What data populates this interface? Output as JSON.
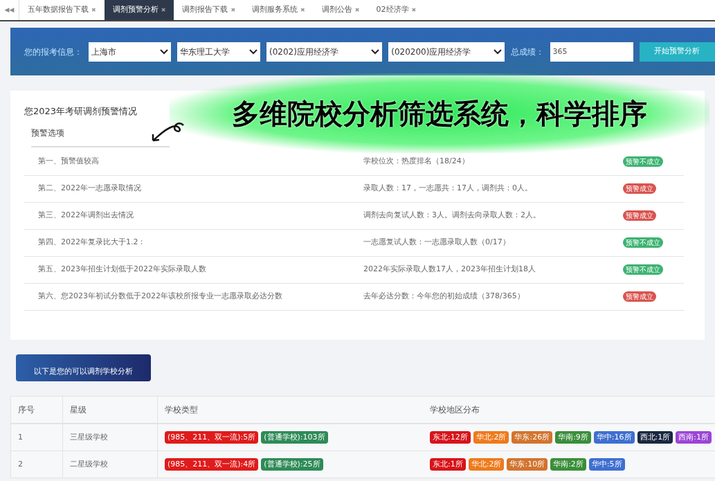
{
  "tab_bar": {
    "scroll_glyph": "◀◀",
    "tabs": [
      {
        "label": "五年数据报告下载",
        "selected": false
      },
      {
        "label": "调剂预警分析",
        "selected": true
      },
      {
        "label": "调剂报告下载",
        "selected": false
      },
      {
        "label": "调剂服务系统",
        "selected": false
      },
      {
        "label": "调剂公告",
        "selected": false
      },
      {
        "label": "02经济学",
        "selected": false
      }
    ],
    "close_glyph": "✖"
  },
  "form": {
    "label": "您的报考信息：",
    "selects": [
      "上海市",
      "华东理工大学",
      "(0202)应用经济学",
      "(020200)应用经济学"
    ],
    "score_label": "总成绩：",
    "score_value": "365",
    "button": "开始预警分析"
  },
  "warning_card": {
    "title": "您2023年考研调剂预警情况",
    "header": "预警选项",
    "rows": [
      {
        "item": "第一、预警值较高",
        "detail": "学校位次：热度排名（18/24）",
        "badge": {
          "label": "预警不成立",
          "color": "#3cb371"
        }
      },
      {
        "item": "第二、2022年一志愿录取情况",
        "detail": "录取人数：17，一志愿共：17人，调剂共：0人。",
        "badge": {
          "label": "预警成立",
          "color": "#d9534f"
        }
      },
      {
        "item": "第三、2022年调剂出去情况",
        "detail": "调剂去向复试人数：3人。调剂去向录取人数：2人。",
        "badge": {
          "label": "预警成立",
          "color": "#d9534f"
        }
      },
      {
        "item": "第四、2022年复录比大于1.2：",
        "detail": "一志愿复试人数：一志愿录取人数（0/17）",
        "badge": {
          "label": "预警不成立",
          "color": "#3cb371"
        }
      },
      {
        "item": "第五、2023年招生计划低于2022年实际录取人数",
        "detail": "2022年实际录取人数17人，2023年招生计划18人",
        "badge": {
          "label": "预警不成立",
          "color": "#3cb371"
        }
      },
      {
        "item": "第六、您2023年初试分数低于2022年该校所报专业一志愿录取必达分数",
        "detail": "去年必达分数：今年您的初始成绩（378/365）",
        "badge": {
          "label": "预警成立",
          "color": "#d9534f"
        }
      }
    ]
  },
  "overlay_caption": "多维院校分析筛选系统，科学排序",
  "section_button": "以下是您的可以调剂学校分析",
  "table": {
    "columns": [
      "序号",
      "星级",
      "学校类型",
      "学校地区分布"
    ],
    "rows": [
      {
        "index": "1",
        "level": "三星级学校",
        "types": [
          {
            "label": "(985、211、双一流):5所",
            "color": "#e01b1b"
          },
          {
            "label": "(普通学校):103所",
            "color": "#2e8b57"
          }
        ],
        "regions": [
          {
            "label": "东北:12所",
            "color": "#d7141a"
          },
          {
            "label": "华北:2所",
            "color": "#ee7a1c"
          },
          {
            "label": "华东:26所",
            "color": "#d2742e"
          },
          {
            "label": "华南:9所",
            "color": "#3a8e3a"
          },
          {
            "label": "华中:16所",
            "color": "#3f6fd0"
          },
          {
            "label": "西北:1所",
            "color": "#1a2740"
          },
          {
            "label": "西南:1所",
            "color": "#9b45d6"
          }
        ]
      },
      {
        "index": "2",
        "level": "二星级学校",
        "types": [
          {
            "label": "(985、211、双一流):4所",
            "color": "#e01b1b"
          },
          {
            "label": "(普通学校):25所",
            "color": "#2e8b57"
          }
        ],
        "regions": [
          {
            "label": "东北:1所",
            "color": "#d7141a"
          },
          {
            "label": "华北:2所",
            "color": "#ee7a1c"
          },
          {
            "label": "华东:10所",
            "color": "#d2742e"
          },
          {
            "label": "华南:2所",
            "color": "#3a8e3a"
          },
          {
            "label": "华中:5所",
            "color": "#3f6fd0"
          }
        ]
      }
    ]
  }
}
